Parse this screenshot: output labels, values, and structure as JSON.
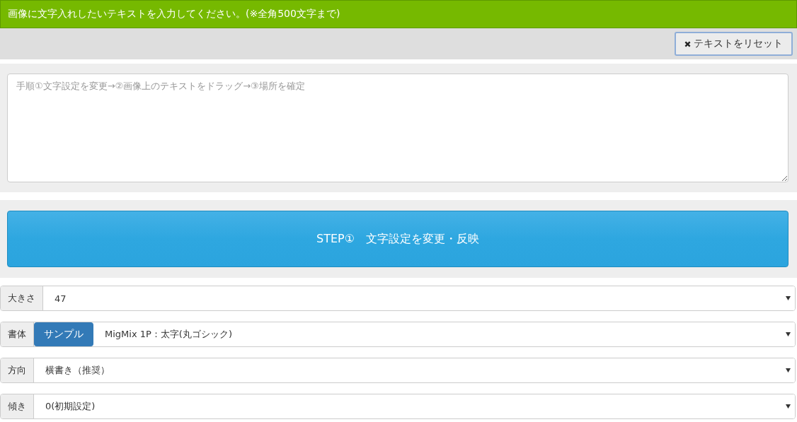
{
  "header": {
    "title": "画像に文字入れしたいテキストを入力してください。(※全角500文字まで)"
  },
  "reset_button": {
    "label": "テキストをリセット"
  },
  "text_input": {
    "placeholder": "手順①文字設定を変更→②画像上のテキストをドラッグ→③場所を確定"
  },
  "step_button": {
    "label": "STEP①　文字設定を変更・反映"
  },
  "settings": [
    {
      "label": "大きさ",
      "value": "47"
    },
    {
      "label": "書体",
      "sample_button": "サンプル",
      "value": "MigMix 1P：太字(丸ゴシック)"
    },
    {
      "label": "方向",
      "value": "横書き（推奨）"
    },
    {
      "label": "傾き",
      "value": "0(初期設定)"
    }
  ]
}
